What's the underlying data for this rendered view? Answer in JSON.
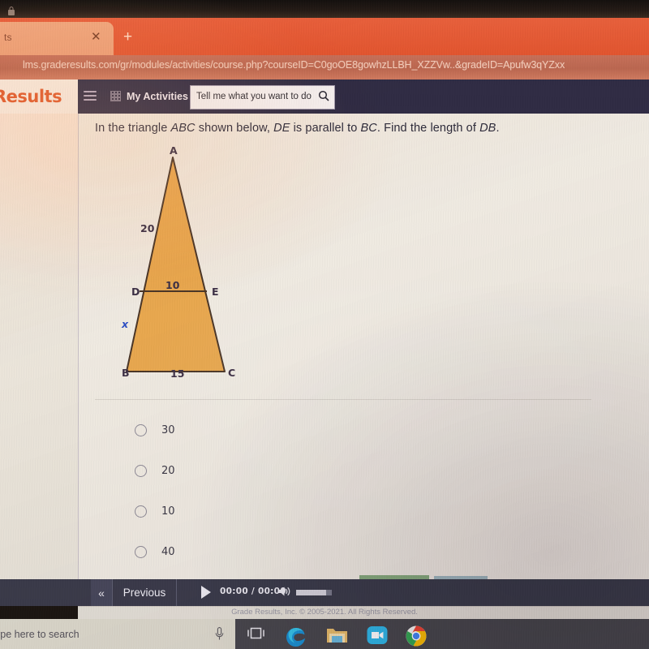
{
  "browser": {
    "tab_title": "ts",
    "tab_close_icon": "close-icon",
    "new_tab_icon": "plus-icon",
    "lock_icon": "lock-icon",
    "url": "lms.graderesults.com/gr/modules/activities/course.php?courseID=C0goOE8gowhzLLBH_XZZVw..&gradeID=Apufw3qYZxx"
  },
  "lms_nav": {
    "logo": "Results",
    "hamburger_icon": "hamburger-menu-icon",
    "my_activities_icon": "grid-icon",
    "my_activities": "My Activities",
    "search_placeholder": "Tell me what you want to do",
    "search_icon": "search-icon"
  },
  "question": {
    "prefix": "In the triangle ",
    "tri1": "ABC",
    "mid1": " shown below, ",
    "tri2": "DE",
    "mid2": " is parallel to ",
    "tri3": "BC",
    "suffix": ". Find the length of ",
    "tri4": "DB",
    "period": "."
  },
  "figure": {
    "vertex_a": "A",
    "vertex_b": "B",
    "vertex_c": "C",
    "vertex_d": "D",
    "vertex_e": "E",
    "side_ad": "20",
    "segment_de": "10",
    "side_db": "x",
    "base_bc": "15",
    "fill_color": "#e8a74e",
    "stroke_color": "#4a3526",
    "label_color": "#3c2f45",
    "x_color": "#2d4ec4"
  },
  "options": [
    {
      "label": "30",
      "selected": false
    },
    {
      "label": "20",
      "selected": false
    },
    {
      "label": "10",
      "selected": false
    },
    {
      "label": "40",
      "selected": false
    }
  ],
  "player": {
    "prev_chevron": "«",
    "previous_label": "Previous",
    "play_icon": "play-icon",
    "time": "00:00 / 00:00",
    "speaker_icon": "volume-icon"
  },
  "footer": {
    "copyright": "Grade Results, Inc. © 2005-2021. All Rights Reserved."
  },
  "taskbar": {
    "search_text": "ype here to search",
    "mic_icon": "microphone-icon",
    "taskview_icon": "task-view-icon",
    "edge_icon": "edge-browser-icon",
    "explorer_icon": "file-explorer-icon",
    "zoom_icon": "zoom-app-icon",
    "chrome_icon": "chrome-browser-icon"
  }
}
